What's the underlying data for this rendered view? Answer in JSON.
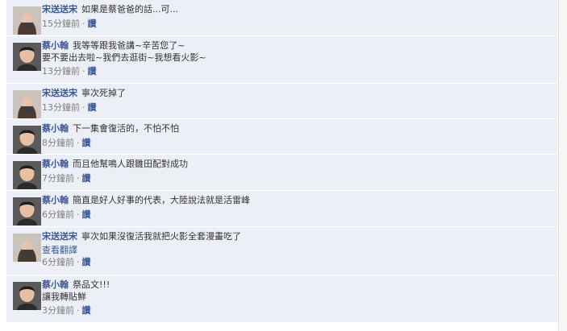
{
  "comments": [
    {
      "author": "宋送送宋",
      "avatar": "girl",
      "text": "如果是蔡爸爸的話...可...",
      "line2": "",
      "translate": "",
      "time": "15分鐘前",
      "like": "讚"
    },
    {
      "author": "蔡小翰",
      "avatar": "boy",
      "text": "我等等跟我爸講~辛苦您了~",
      "line2": "要不要出去啦~我們去逛街~我想看火影~",
      "translate": "",
      "time": "13分鐘前",
      "like": "讚"
    },
    {
      "author": "宋送送宋",
      "avatar": "girl",
      "text": "寧次死掉了",
      "line2": "",
      "translate": "",
      "time": "13分鐘前",
      "like": "讚"
    },
    {
      "author": "蔡小翰",
      "avatar": "boy",
      "text": "下一集會復活的，不怕不怕",
      "line2": "",
      "translate": "",
      "time": "8分鐘前",
      "like": "讚"
    },
    {
      "author": "蔡小翰",
      "avatar": "boy",
      "text": "而且他幫鳴人跟雛田配對成功",
      "line2": "",
      "translate": "",
      "time": "7分鐘前",
      "like": "讚"
    },
    {
      "author": "蔡小翰",
      "avatar": "boy",
      "text": "簡直是好人好事的代表，大陸說法就是活雷峰",
      "line2": "",
      "translate": "",
      "time": "6分鐘前",
      "like": "讚"
    },
    {
      "author": "宋送送宋",
      "avatar": "girl",
      "text": "寧次如果沒復活我就把火影全套漫畫吃了",
      "line2": "",
      "translate": "查看翻譯",
      "time": "6分鐘前",
      "like": "讚"
    },
    {
      "author": "蔡小翰",
      "avatar": "boy",
      "text": "祭品文!!!",
      "line2": "讓我轉貼鮮",
      "translate": "",
      "time": "3分鐘前",
      "like": "讚"
    }
  ],
  "colors": {
    "link": "#3b5998",
    "row_bg": "#eceff5",
    "meta": "#808080"
  }
}
